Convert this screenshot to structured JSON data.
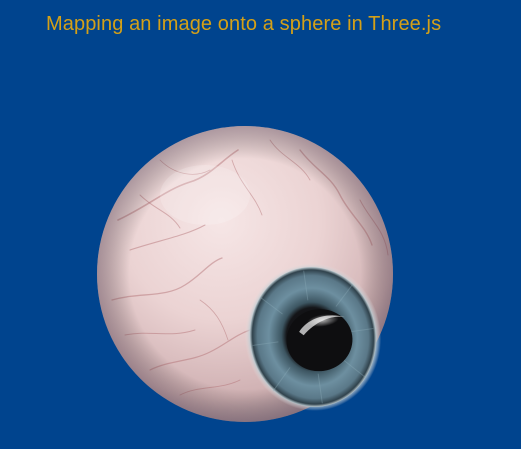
{
  "page": {
    "title": "Mapping an image onto a sphere in Three.js"
  },
  "scene": {
    "object": "eyeball",
    "colors": {
      "background": "#00448e",
      "title": "#d4a017",
      "sclera": "#e9d3d4",
      "iris": "#6f8ea0",
      "pupil": "#101010"
    }
  }
}
